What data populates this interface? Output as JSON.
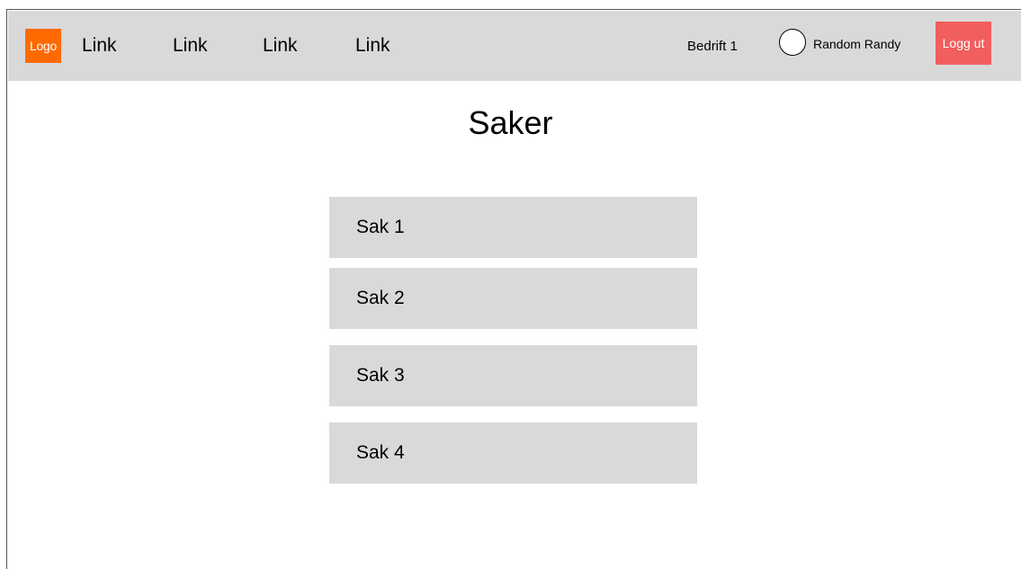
{
  "navbar": {
    "logo_text": "Logo",
    "links": [
      "Link",
      "Link",
      "Link",
      "Link"
    ],
    "company": "Bedrift 1",
    "user_name": "Random Randy",
    "logout_label": "Logg ut"
  },
  "page": {
    "title": "Saker"
  },
  "cases": [
    "Sak 1",
    "Sak 2",
    "Sak 3",
    "Sak 4"
  ],
  "colors": {
    "navbar_bg": "#d9d9d9",
    "logo_bg": "#ff6a00",
    "logout_bg": "#f25e5e",
    "case_bg": "#d9d9d9"
  },
  "icons": {
    "avatar": "user-avatar-circle"
  }
}
